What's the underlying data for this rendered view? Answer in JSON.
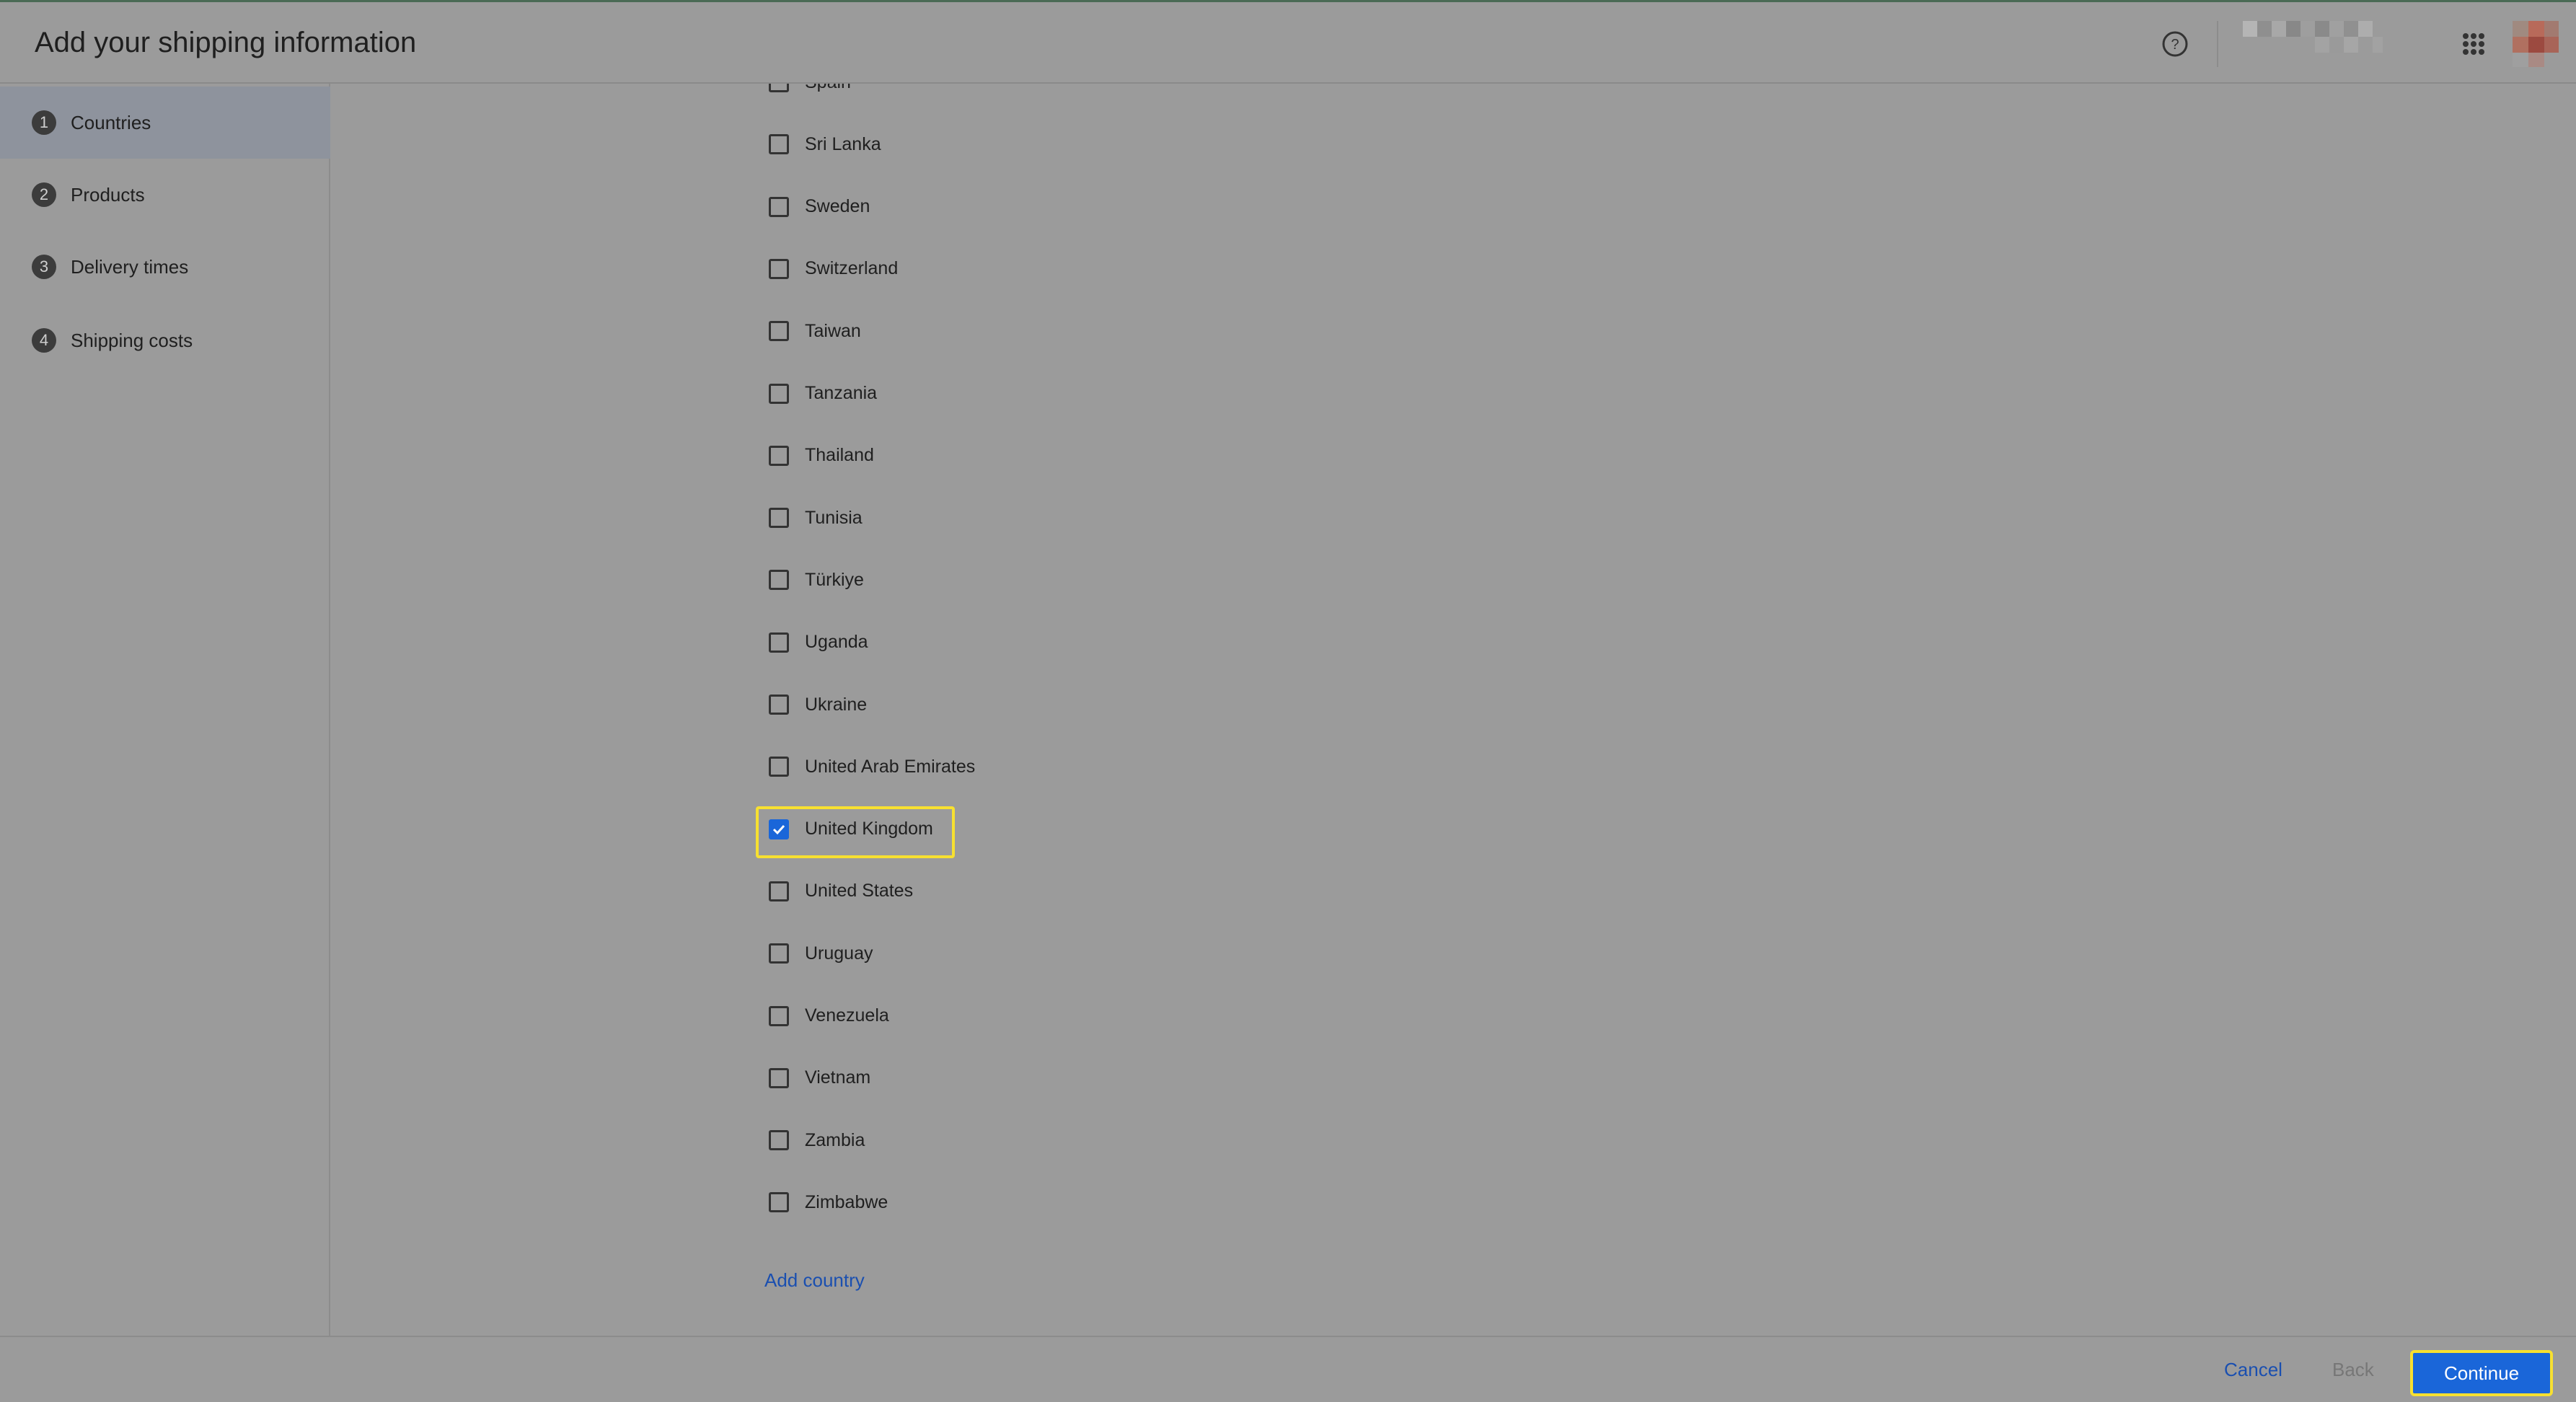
{
  "header": {
    "title": "Add your shipping information",
    "help_icon": "help-circle-icon",
    "apps_icon": "apps-grid-icon"
  },
  "sidebar": {
    "steps": [
      {
        "number": "1",
        "label": "Countries",
        "active": true
      },
      {
        "number": "2",
        "label": "Products",
        "active": false
      },
      {
        "number": "3",
        "label": "Delivery times",
        "active": false
      },
      {
        "number": "4",
        "label": "Shipping costs",
        "active": false
      }
    ]
  },
  "countries": [
    {
      "label": "Spain",
      "checked": false
    },
    {
      "label": "Sri Lanka",
      "checked": false
    },
    {
      "label": "Sweden",
      "checked": false
    },
    {
      "label": "Switzerland",
      "checked": false
    },
    {
      "label": "Taiwan",
      "checked": false
    },
    {
      "label": "Tanzania",
      "checked": false
    },
    {
      "label": "Thailand",
      "checked": false
    },
    {
      "label": "Tunisia",
      "checked": false
    },
    {
      "label": "Türkiye",
      "checked": false
    },
    {
      "label": "Uganda",
      "checked": false
    },
    {
      "label": "Ukraine",
      "checked": false
    },
    {
      "label": "United Arab Emirates",
      "checked": false
    },
    {
      "label": "United Kingdom",
      "checked": true
    },
    {
      "label": "United States",
      "checked": false
    },
    {
      "label": "Uruguay",
      "checked": false
    },
    {
      "label": "Venezuela",
      "checked": false
    },
    {
      "label": "Vietnam",
      "checked": false
    },
    {
      "label": "Zambia",
      "checked": false
    },
    {
      "label": "Zimbabwe",
      "checked": false
    }
  ],
  "add_country_label": "Add country",
  "footer": {
    "cancel_label": "Cancel",
    "back_label": "Back",
    "continue_label": "Continue"
  },
  "colors": {
    "accent": "#1a66d9",
    "highlight": "#f7e030",
    "link": "#1a4fb0"
  }
}
